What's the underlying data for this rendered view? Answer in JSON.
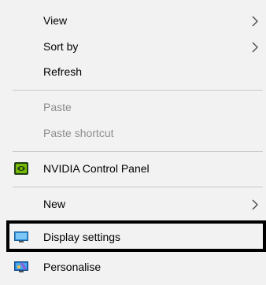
{
  "menu": {
    "items": [
      {
        "label": "View",
        "submenu": true,
        "enabled": true
      },
      {
        "label": "Sort by",
        "submenu": true,
        "enabled": true
      },
      {
        "label": "Refresh",
        "submenu": false,
        "enabled": true
      },
      {
        "label": "Paste",
        "submenu": false,
        "enabled": false
      },
      {
        "label": "Paste shortcut",
        "submenu": false,
        "enabled": false
      },
      {
        "label": "NVIDIA Control Panel",
        "submenu": false,
        "enabled": true,
        "icon": "nvidia-icon"
      },
      {
        "label": "New",
        "submenu": true,
        "enabled": true
      },
      {
        "label": "Display settings",
        "submenu": false,
        "enabled": true,
        "icon": "display-icon",
        "highlighted": true
      },
      {
        "label": "Personalise",
        "submenu": false,
        "enabled": true,
        "icon": "personalise-icon"
      }
    ]
  },
  "colors": {
    "menu_background": "#f2f2f2",
    "disabled_text": "#8d8d8d",
    "separator": "#c9c9c9",
    "highlight_border": "#000000",
    "nvidia_green": "#76b900"
  }
}
